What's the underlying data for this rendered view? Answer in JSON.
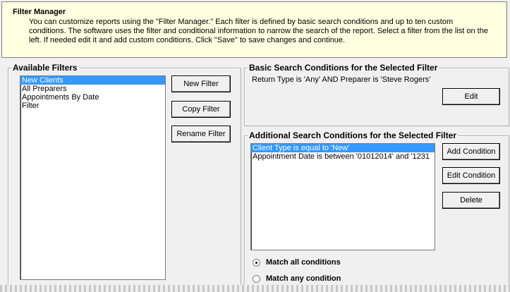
{
  "banner": {
    "title": "Filter Manager",
    "lines": [
      "You can customize reports using the \"Filter Manager.\"  Each filter is defined by basic search conditions and up to ten custom",
      "conditions.  The software uses the filter and conditional information to narrow the search of the report.  Select a filter from the list on the",
      "left.  If needed edit it and add custom conditions.  Click \"Save\" to save changes and continue."
    ]
  },
  "available": {
    "legend": "Available Filters",
    "items": [
      "New Clients",
      "All Preparers",
      "Appointments By Date",
      "Filter"
    ],
    "selected_index": 0
  },
  "buttons": {
    "new_filter": "New Filter",
    "copy_filter": "Copy Filter",
    "rename_filter": "Rename Filter",
    "edit": "Edit",
    "add_condition": "Add Condition",
    "edit_condition": "Edit Condition",
    "delete": "Delete"
  },
  "basic": {
    "legend": "Basic Search Conditions for the Selected Filter",
    "text": "Return Type is 'Any' AND Preparer is 'Steve Rogers'"
  },
  "additional": {
    "legend": "Additional Search Conditions for the Selected Filter",
    "items": [
      "Client Type is equal to 'New'",
      "Appointment Date is between '01012014' and '1231"
    ],
    "selected_index": 0
  },
  "match": {
    "all_label": "Match all conditions",
    "any_label": "Match any condition",
    "selected": "all"
  }
}
